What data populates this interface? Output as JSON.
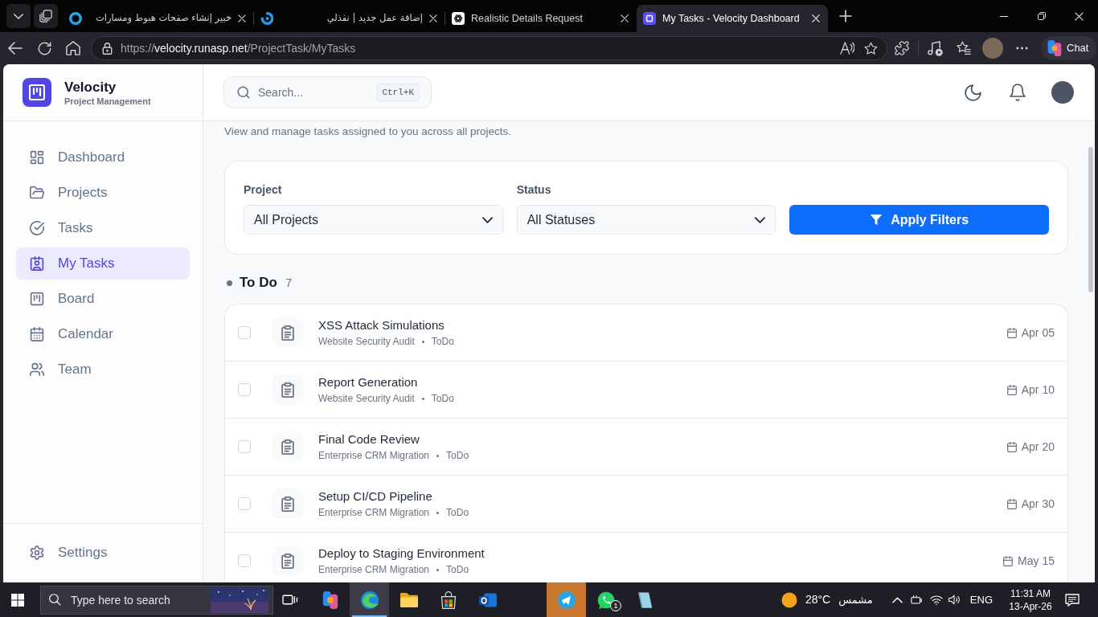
{
  "browser": {
    "tabs": [
      {
        "title": "خبير إنشاء صفحات هبوط ومسارات",
        "selected": false
      },
      {
        "title": "إضافة عمل جديد | نفذلي",
        "selected": false
      },
      {
        "title": "Realistic Details Request",
        "selected": false
      },
      {
        "title": "My Tasks - Velocity Dashboard",
        "selected": true
      }
    ],
    "address": {
      "scheme": "https://",
      "host": "velocity.runasp.net",
      "path": "/ProjectTask/MyTasks"
    },
    "chat_button": "Chat"
  },
  "sidebar": {
    "brand": {
      "name": "Velocity",
      "tagline": "Project Management"
    },
    "items": [
      {
        "label": "Dashboard",
        "selected": false
      },
      {
        "label": "Projects",
        "selected": false
      },
      {
        "label": "Tasks",
        "selected": false
      },
      {
        "label": "My Tasks",
        "selected": true
      },
      {
        "label": "Board",
        "selected": false
      },
      {
        "label": "Calendar",
        "selected": false
      },
      {
        "label": "Team",
        "selected": false
      }
    ],
    "footer_item": {
      "label": "Settings"
    }
  },
  "header": {
    "search": {
      "placeholder": "Search...",
      "shortcut": "Ctrl+K"
    }
  },
  "page": {
    "description": "View and manage tasks assigned to you across all projects."
  },
  "filters": {
    "fields": [
      {
        "label": "Project",
        "value": "All Projects"
      },
      {
        "label": "Status",
        "value": "All Statuses"
      }
    ],
    "apply_button": "Apply Filters"
  },
  "task_groups": [
    {
      "title": "To Do",
      "count": "7",
      "tasks": [
        {
          "title": "XSS Attack Simulations",
          "project": "Website Security Audit",
          "status": "ToDo",
          "due": "Apr 05",
          "checked": false
        },
        {
          "title": "Report Generation",
          "project": "Website Security Audit",
          "status": "ToDo",
          "due": "Apr 10",
          "checked": false
        },
        {
          "title": "Final Code Review",
          "project": "Enterprise CRM Migration",
          "status": "ToDo",
          "due": "Apr 20",
          "checked": false
        },
        {
          "title": "Setup CI/CD Pipeline",
          "project": "Enterprise CRM Migration",
          "status": "ToDo",
          "due": "Apr 30",
          "checked": false
        },
        {
          "title": "Deploy to Staging Environment",
          "project": "Enterprise CRM Migration",
          "status": "ToDo",
          "due": "May 15",
          "checked": false
        }
      ]
    }
  ],
  "taskbar": {
    "search": {
      "placeholder": "Type here to search"
    },
    "apps": [
      {
        "active": false,
        "flashing": false
      },
      {
        "active": false,
        "flashing": false
      },
      {
        "active": true,
        "flashing": false
      },
      {
        "active": false,
        "flashing": false
      },
      {
        "active": false,
        "flashing": false
      },
      {
        "active": false,
        "flashing": false
      },
      {
        "active": false,
        "flashing": true
      },
      {
        "active": false,
        "flashing": false,
        "badge": "1"
      },
      {
        "active": false,
        "flashing": false
      }
    ],
    "weather": {
      "temperature": "28°C",
      "condition": "مشمس"
    },
    "language": "ENG",
    "time": "11:31 AM",
    "date": "13-Apr-26"
  }
}
